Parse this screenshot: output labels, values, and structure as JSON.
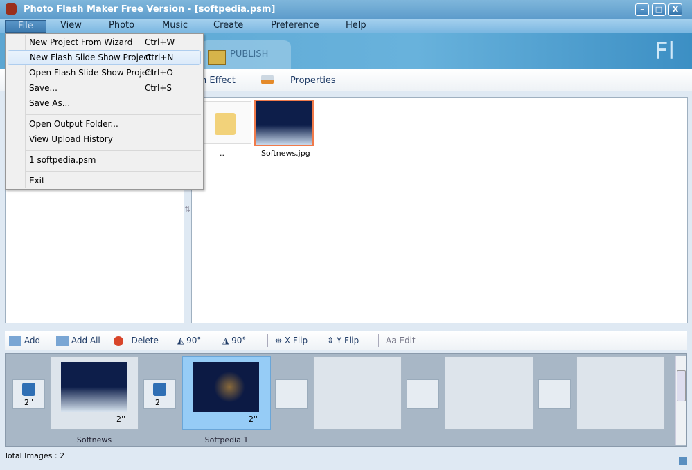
{
  "window": {
    "title": "Photo Flash Maker Free Version - [softpedia.psm]",
    "min": "–",
    "max": "□",
    "close": "X"
  },
  "menubar": [
    "File",
    "View",
    "Photo",
    "Music",
    "Create",
    "Preference",
    "Help"
  ],
  "banner": {
    "publish_tab": "PUBLISH",
    "logo": "Fl"
  },
  "toolbar": {
    "effect": "n Effect",
    "properties": "Properties"
  },
  "file_menu": [
    {
      "label": "New Project From Wizard",
      "shortcut": "Ctrl+W"
    },
    {
      "label": "New Flash Slide Show Project",
      "shortcut": "Ctrl+N"
    },
    {
      "label": "Open Flash Slide Show Project",
      "shortcut": "Ctrl+O"
    },
    {
      "label": "Save...",
      "shortcut": "Ctrl+S"
    },
    {
      "label": "Save As...",
      "shortcut": ""
    },
    {
      "label": "Open Output Folder...",
      "shortcut": ""
    },
    {
      "label": "View Upload History",
      "shortcut": ""
    },
    {
      "label": "1 softpedia.psm",
      "shortcut": ""
    },
    {
      "label": "Exit",
      "shortcut": ""
    }
  ],
  "browser": {
    "items": [
      {
        "label": ".."
      },
      {
        "label": "Softnews.jpg"
      }
    ]
  },
  "bottom_toolbar": {
    "add": "Add",
    "add_all": "Add All",
    "delete": "Delete",
    "rot_left": "90°",
    "rot_right": "90°",
    "xflip": "X Flip",
    "yflip": "Y Flip",
    "edit": "Edit"
  },
  "storyboard": {
    "transitions": [
      "2''",
      "2''"
    ],
    "slides": [
      {
        "name": "Softnews",
        "duration": "2''"
      },
      {
        "name": "Softpedia 1",
        "duration": "2''"
      }
    ]
  },
  "status": {
    "total": "Total Images : 2"
  },
  "colors": {
    "accent": "#5d9ccb",
    "selected": "#96ccf6",
    "selection_border": "#f07a4a"
  }
}
